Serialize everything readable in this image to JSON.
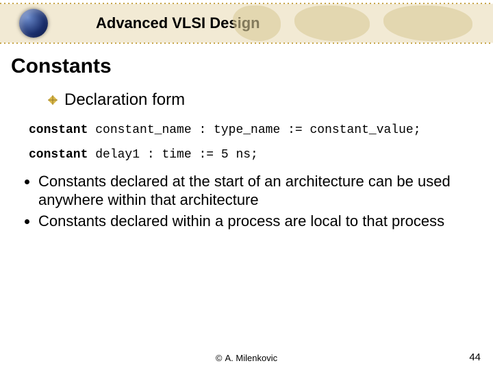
{
  "header": {
    "course_title": "Advanced VLSI Design"
  },
  "slide": {
    "title": "Constants",
    "subheading": "Declaration form",
    "code": {
      "line1_kw": "constant",
      "line1_rest": " constant_name : type_name := constant_value;",
      "line2_kw": "constant",
      "line2_rest": " delay1 : time := 5 ns;"
    },
    "bullets": [
      "Constants declared at the start of an architecture can be used anywhere within that architecture",
      "Constants declared within a process are local to that process"
    ]
  },
  "footer": {
    "copyright_symbol": "©",
    "author": "A. Milenkovic",
    "page_number": "44"
  }
}
